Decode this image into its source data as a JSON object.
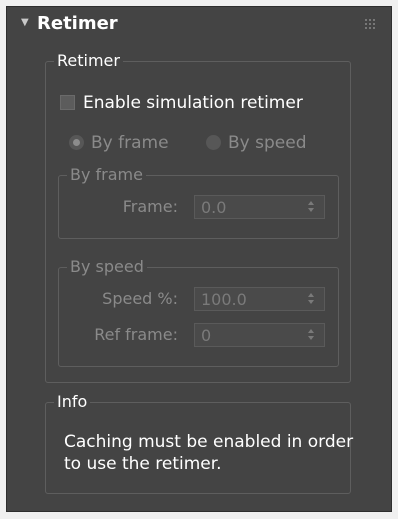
{
  "rollout": {
    "title": "Retimer",
    "collapse_icon": "triangle-down-icon",
    "grip_icon": "grip-dots-icon"
  },
  "retimer_group": {
    "legend": "Retimer",
    "enable_checkbox_label": "Enable simulation retimer",
    "enable_checked": false,
    "radio_by_frame": "By frame",
    "radio_by_speed": "By speed",
    "selected_mode": "By frame"
  },
  "by_frame_group": {
    "legend": "By frame",
    "frame_label": "Frame:",
    "frame_value": "0.0"
  },
  "by_speed_group": {
    "legend": "By speed",
    "speed_label": "Speed %:",
    "speed_value": "100.0",
    "ref_frame_label": "Ref frame:",
    "ref_frame_value": "0"
  },
  "info_group": {
    "legend": "Info",
    "text": "Caching must be enabled in order to use the retimer."
  },
  "colors": {
    "panel_bg": "#444444",
    "text": "#ffffff",
    "disabled_text": "#8a8a8a",
    "group_border": "#5e5e5e"
  }
}
